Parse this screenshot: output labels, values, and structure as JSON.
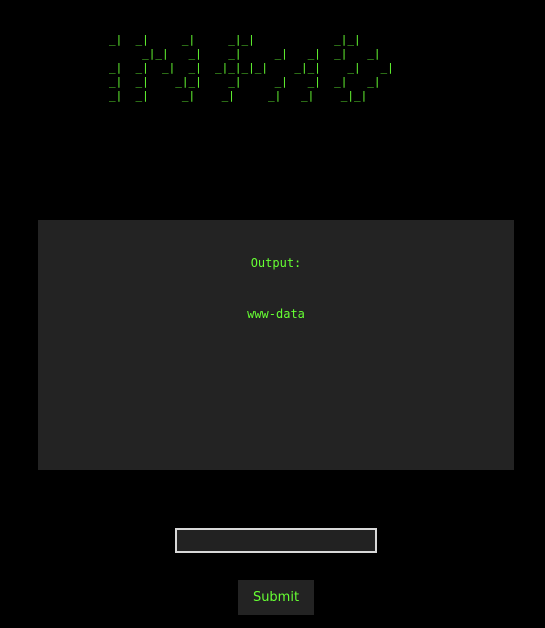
{
  "banner": {
    "ascii_art": "_|  _|     _|     _|_|            _|_|\n     _|_|   _|    _|     _|   _|  _|   _|\n_|  _|  _|  _|  _|_|_|_|    _|_|    _|   _|\n_|  _|    _|_|    _|     _|   _|  _|   _|\n_|  _|     _|    _|     _|   _|    _|_|"
  },
  "output": {
    "label": "Output:",
    "value": "www-data"
  },
  "form": {
    "input_value": "",
    "submit_label": "Submit"
  },
  "colors": {
    "background": "#000000",
    "panel": "#232323",
    "accent_text": "#66ff33",
    "input_border": "#d8d8d8"
  }
}
